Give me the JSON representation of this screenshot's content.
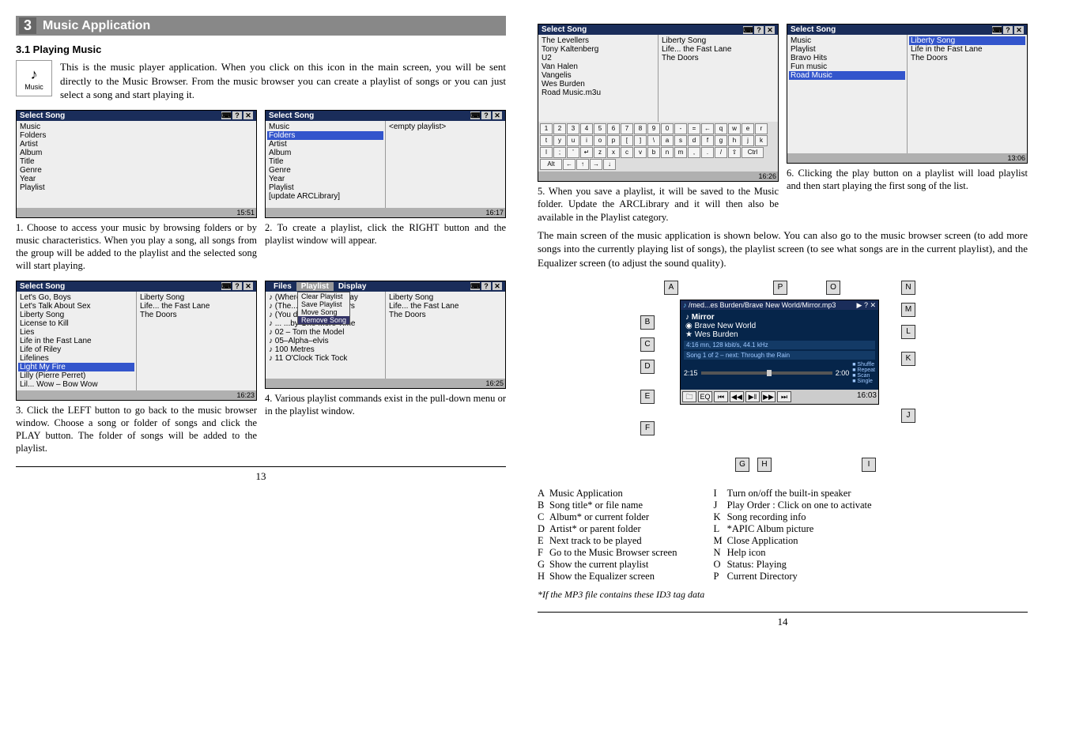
{
  "chapter_num": "3",
  "chapter_title": "Music Application",
  "section": "3.1   Playing Music",
  "intro": "This is the music player application. When you click on this icon in the main screen, you will be sent directly to the Music Browser. From the music browser you can create a playlist of songs or you can just select a song and start playing it.",
  "music_label": "Music",
  "ss_title": "Select Song",
  "s1": {
    "items": [
      "Music",
      "Folders",
      "Artist",
      "Album",
      "Title",
      "Genre",
      "Year",
      "Playlist"
    ],
    "time": "15:51"
  },
  "s2": {
    "items": [
      "Music",
      "Folders",
      "Artist",
      "Album",
      "Title",
      "Genre",
      "Year",
      "Playlist",
      "[update ARCLibrary]"
    ],
    "right": "<empty playlist>",
    "time": "16:17"
  },
  "cap1": "1. Choose to access your music by browsing folders or by music characteristics. When you play a song, all songs from the group will be added to the playlist and the selected song will start playing.",
  "cap2": "2. To create a playlist, click the RIGHT button and the playlist window will appear.",
  "s3": {
    "left": [
      "Let's Go, Boys",
      "Let's Talk About Sex",
      "Liberty Song",
      "License to Kill",
      "Lies",
      "Life in the Fast Lane",
      "Life of Riley",
      "Lifelines",
      "Light My Fire",
      "Lilly (Pierre Perret)",
      "Lil... Wow – Bow Wow"
    ],
    "right": [
      "Liberty Song",
      "Life... the Fast Lane",
      "The Doors"
    ],
    "sel": "Light My Fire",
    "time": "16:23"
  },
  "s4": {
    "menubar": [
      "Files",
      "Playlist",
      "Display"
    ],
    "menu": [
      "Clear Playlist",
      "Save Playlist",
      "Move Song",
      "Remove Song"
    ],
    "songs": [
      "(Where Rainbo...) away",
      "(The... for the Holidays",
      "(You drive me) Crazy",
      "... ...by One More Time",
      "02 – Tom the Model",
      "05–Alpha–elvis",
      "100 Metres",
      "11 O'Clock Tick Tock"
    ],
    "right": [
      "Liberty Song",
      "Life... the Fast Lane",
      "The Doors"
    ],
    "time": "16:25"
  },
  "cap3": "3. Click the LEFT button to go back to the music browser window. Choose a song or folder of songs and click the PLAY button. The folder of songs will be added to the playlist.",
  "cap4": "4. Various playlist commands exist in the pull-down menu or in the playlist window.",
  "s5": {
    "left": [
      "The Levellers",
      "Tony Kaltenberg",
      "U2",
      "Van Halen",
      "Vangelis",
      "Wes Burden",
      "Road Music.m3u"
    ],
    "right": [
      "Liberty Song",
      "Life... the Fast Lane",
      "The Doors"
    ],
    "time": "16:26",
    "kbd": [
      "1",
      "2",
      "3",
      "4",
      "5",
      "6",
      "7",
      "8",
      "9",
      "0",
      "-",
      "=",
      "←",
      "q",
      "w",
      "e",
      "r",
      "t",
      "y",
      "u",
      "i",
      "o",
      "p",
      "[",
      "]",
      "\\",
      "a",
      "s",
      "d",
      "f",
      "g",
      "h",
      "j",
      "k",
      "l",
      ";",
      "'",
      "↵",
      "z",
      "x",
      "c",
      "v",
      "b",
      "n",
      "m",
      ",",
      ".",
      "/",
      "⇧",
      "Ctrl",
      "Alt",
      "←",
      "↑",
      "→",
      "↓"
    ]
  },
  "s6": {
    "left": [
      "Music",
      "Playlist",
      "Bravo Hits",
      "Fun music",
      "Road Music"
    ],
    "right": [
      "Liberty Song",
      "Life in the Fast Lane",
      "The Doors"
    ],
    "sel": "Road Music",
    "rsel": "Liberty Song",
    "time": "13:06"
  },
  "cap5": "5. When you save a playlist, it will be saved to the Music folder. Update the ARCLibrary and it will then also be available in the Playlist category.",
  "cap6": "6. Clicking the play button on a playlist will load playlist and then start playing the first song of the list.",
  "main_para": "The main screen of the music application is shown below. You can also go to the music browser screen (to add more songs into the currently playing list of songs), the playlist screen (to see what songs are in the current playlist), and the Equalizer screen (to adjust the sound quality).",
  "player": {
    "path": "/med...es Burden/Brave New World/Mirror.mp3",
    "title": "Mirror",
    "album": "Brave New World",
    "artist": "Wes Burden",
    "info1": "4:16 mn,  128 kbit/s,  44.1 kHz",
    "info2": "Song 1 of 2 – next: Through the Rain",
    "t1": "2:15",
    "t2": "2:00",
    "side": [
      "Shuffle",
      "Repeat",
      "Scan",
      "Single"
    ],
    "sb": "16:03"
  },
  "tagA": "A",
  "tagB": "B",
  "tagC": "C",
  "tagD": "D",
  "tagE": "E",
  "tagF": "F",
  "tagG": "G",
  "tagH": "H",
  "tagI": "I",
  "tagJ": "J",
  "tagK": "K",
  "tagL": "L",
  "tagM": "M",
  "tagN": "N",
  "tagO": "O",
  "tagP": "P",
  "leg": [
    [
      "A",
      "Music Application"
    ],
    [
      "B",
      "Song title* or file name"
    ],
    [
      "C",
      "Album* or current folder"
    ],
    [
      "D",
      "Artist* or parent folder"
    ],
    [
      "E",
      "Next track to be played"
    ],
    [
      "F",
      "Go to the Music Browser screen"
    ],
    [
      "G",
      "Show the current playlist"
    ],
    [
      "H",
      "Show the Equalizer screen"
    ],
    [
      "I",
      "Turn on/off the built-in speaker"
    ],
    [
      "J",
      "Play Order : Click on one to activate"
    ],
    [
      "K",
      "Song recording info"
    ],
    [
      "L",
      "*APIC Album picture"
    ],
    [
      "M",
      "Close Application"
    ],
    [
      "N",
      "Help icon"
    ],
    [
      "O",
      "Status: Playing"
    ],
    [
      "P",
      "Current Directory"
    ]
  ],
  "footnote": "*If the MP3 file contains these ID3 tag data",
  "p13": "13",
  "p14": "14"
}
